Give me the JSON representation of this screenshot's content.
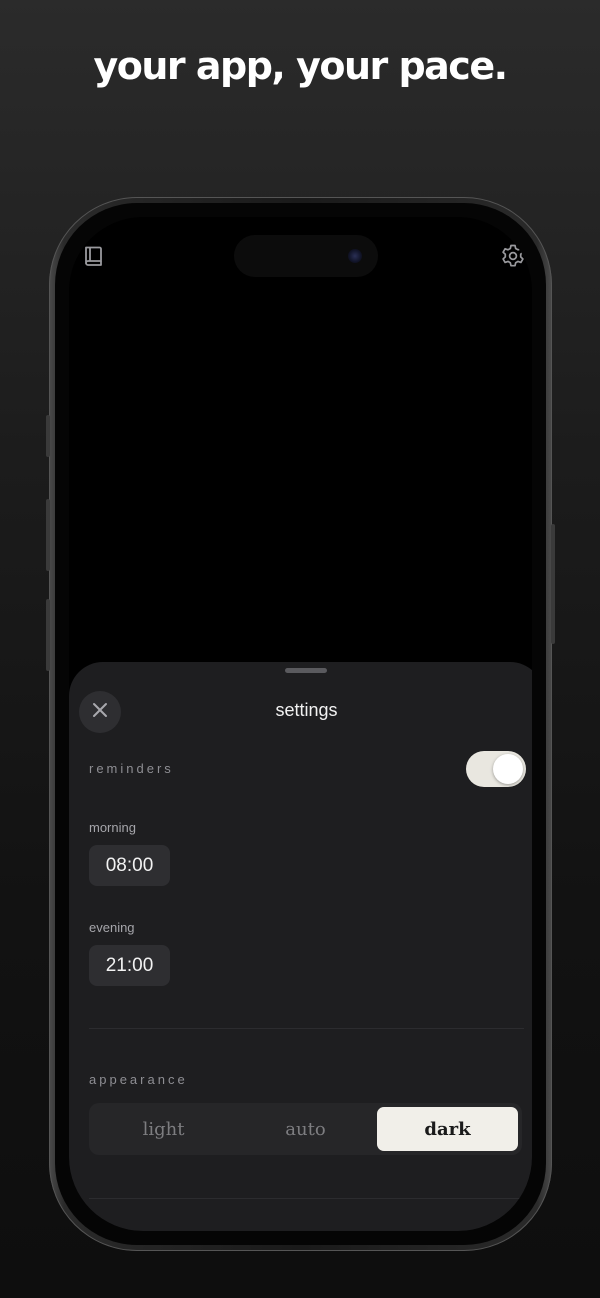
{
  "headline": "your app, your pace.",
  "status_icons": {
    "left": "book-icon",
    "right": "gear-icon"
  },
  "settings": {
    "title": "settings",
    "close_icon": "close-icon",
    "reminders": {
      "label": "reminders",
      "enabled": true
    },
    "morning": {
      "label": "morning",
      "time": "08:00"
    },
    "evening": {
      "label": "evening",
      "time": "21:00"
    },
    "appearance": {
      "label": "appearance",
      "options": [
        "light",
        "auto",
        "dark"
      ],
      "selected": "dark"
    }
  },
  "colors": {
    "sheet_bg": "#1e1e20",
    "control_bg": "#2e2e31",
    "active_segment": "#f1efe9",
    "toggle_on": "#e9e7e0"
  }
}
